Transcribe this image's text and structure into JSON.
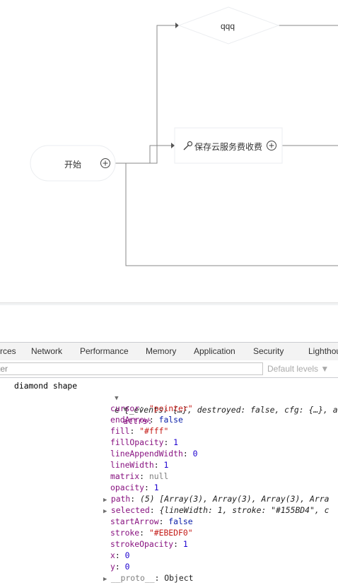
{
  "canvas": {
    "nodes": {
      "diamond_label": "qqq",
      "start_label": "开始",
      "action_label": "保存云服务费收费"
    },
    "colors": {
      "edge": "#888888",
      "node_border": "#EBEDF0",
      "node_fill": "#ffffff"
    }
  },
  "devtools": {
    "tabs": [
      "rces",
      "Network",
      "Performance",
      "Memory",
      "Application",
      "Security",
      "Lighthou"
    ],
    "filter": {
      "value": "ter"
    },
    "levels_label": "Default levels ▼",
    "console": {
      "log_prefix": "diamond shape",
      "object_summary": "e {_events: {…}, destroyed: false, cfg: {…}, att",
      "attrs_label": "attrs:",
      "attrs": [
        {
          "key": "cursor",
          "value": "\"pointer\"",
          "type": "str"
        },
        {
          "key": "endArrow",
          "value": "false",
          "type": "kw"
        },
        {
          "key": "fill",
          "value": "\"#fff\"",
          "type": "str"
        },
        {
          "key": "fillOpacity",
          "value": "1",
          "type": "num"
        },
        {
          "key": "lineAppendWidth",
          "value": "0",
          "type": "num"
        },
        {
          "key": "lineWidth",
          "value": "1",
          "type": "num"
        },
        {
          "key": "matrix",
          "value": "null",
          "type": "nul"
        },
        {
          "key": "opacity",
          "value": "1",
          "type": "num"
        },
        {
          "key": "path",
          "value": "(5) [Array(3), Array(3), Array(3), Arra",
          "type": "obj",
          "expandable": true
        },
        {
          "key": "selected",
          "value": "{lineWidth: 1, stroke: \"#155BD4\", c",
          "type": "obj",
          "expandable": true
        },
        {
          "key": "startArrow",
          "value": "false",
          "type": "kw"
        },
        {
          "key": "stroke",
          "value": "\"#EBEDF0\"",
          "type": "str"
        },
        {
          "key": "strokeOpacity",
          "value": "1",
          "type": "num"
        },
        {
          "key": "x",
          "value": "0",
          "type": "num"
        },
        {
          "key": "y",
          "value": "0",
          "type": "num"
        },
        {
          "key": "__proto__",
          "value": "Object",
          "type": "plain",
          "expandable": true
        }
      ]
    }
  }
}
